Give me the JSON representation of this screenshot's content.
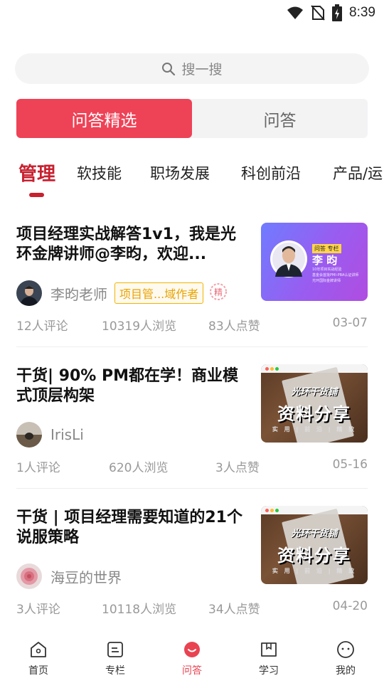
{
  "status_bar": {
    "time": "8:39"
  },
  "search": {
    "placeholder": "搜一搜"
  },
  "segmented": {
    "tabs": [
      "问答精选",
      "问答"
    ],
    "active_index": 0
  },
  "categories": {
    "items": [
      "管理",
      "软技能",
      "职场发展",
      "科创前沿",
      "产品/运"
    ],
    "active_index": 0
  },
  "articles": [
    {
      "title": "项目经理实战解答1v1，我是光环金牌讲师@李昀，欢迎...",
      "author": "李昀老师",
      "tag": "项目管...域作者",
      "seal": "精",
      "stats": {
        "comments": "12人评论",
        "views": "10319人浏览",
        "likes": "83人点赞",
        "date": "03-07"
      },
      "thumb": {
        "style": "purple",
        "tag": "问答 专栏",
        "name": "李 昀",
        "lines": [
          "10年项目实战经验",
          "基金会首批PMI-PBA认证讲师",
          "光环国际金牌讲师"
        ]
      }
    },
    {
      "title": "干货| 90% PM都在学！商业模式顶层构架",
      "author": "IrisLi",
      "tag": "",
      "stats": {
        "comments": "1人评论",
        "views": "620人浏览",
        "likes": "3人点赞",
        "date": "05-16"
      },
      "thumb": {
        "style": "wood",
        "line1": "光环干货铺",
        "line2": "资料分享",
        "line3": "实 用 | 前 沿 | 精 致"
      }
    },
    {
      "title": "干货 | 项目经理需要知道的21个说服策略",
      "author": "海豆的世界",
      "tag": "",
      "stats": {
        "comments": "3人评论",
        "views": "10118人浏览",
        "likes": "34人点赞",
        "date": "04-20"
      },
      "thumb": {
        "style": "wood",
        "line1": "光环干货铺",
        "line2": "资料分享",
        "line3": "实 用 | 前 沿 | 精 致"
      }
    }
  ],
  "bottom_nav": {
    "items": [
      {
        "label": "首页",
        "icon": "home-icon"
      },
      {
        "label": "专栏",
        "icon": "column-icon"
      },
      {
        "label": "问答",
        "icon": "qa-icon"
      },
      {
        "label": "学习",
        "icon": "study-icon"
      },
      {
        "label": "我的",
        "icon": "profile-icon"
      }
    ],
    "active_index": 2,
    "active_color": "#e94352"
  },
  "colors": {
    "accent": "#ee4256",
    "category_active": "#c8202f",
    "tag_border": "#f0b400"
  }
}
